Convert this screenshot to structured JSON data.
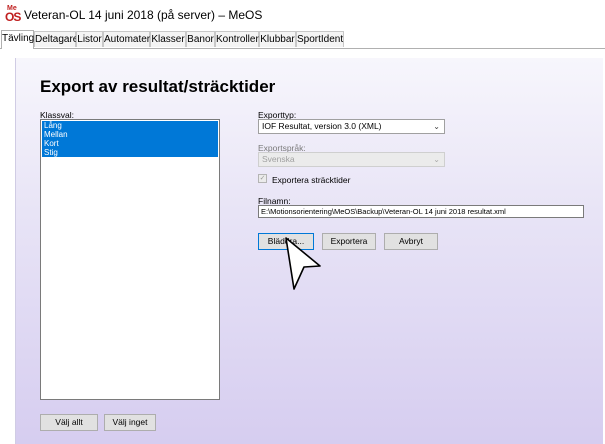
{
  "window": {
    "title": "Veteran-OL 14 juni 2018 (på server) – MeOS",
    "icon_name": "meos-app-icon",
    "icon_mark_top": "Me",
    "icon_mark_bottom": "OS"
  },
  "tabs": [
    "Tävling",
    "Deltagare",
    "Listor",
    "Automater",
    "Klasser",
    "Banor",
    "Kontroller",
    "Klubbar",
    "SportIdent"
  ],
  "page": {
    "heading": "Export av resultat/sträcktider"
  },
  "class_list": {
    "label": "Klassval:",
    "items": [
      "Lång",
      "Mellan",
      "Kort",
      "Stig"
    ]
  },
  "export_type": {
    "label": "Exporttyp:",
    "value": "IOF Resultat, version 3.0 (XML)"
  },
  "export_language": {
    "label": "Exportspråk:",
    "value": "Svenska"
  },
  "export_splits": {
    "label": "Exportera sträcktider",
    "checked": true
  },
  "filename": {
    "label": "Filnamn:",
    "value": "E:\\Motionsorientering\\MeOS\\Backup\\Veteran-OL 14 juni 2018 resultat.xml"
  },
  "buttons": {
    "browse": "Bläddra...",
    "export": "Exportera",
    "cancel": "Avbryt",
    "select_all": "Välj allt",
    "select_none": "Välj inget"
  },
  "colors": {
    "selection": "#0078d7",
    "panel_gradient_bottom": "#d6cdf0"
  }
}
